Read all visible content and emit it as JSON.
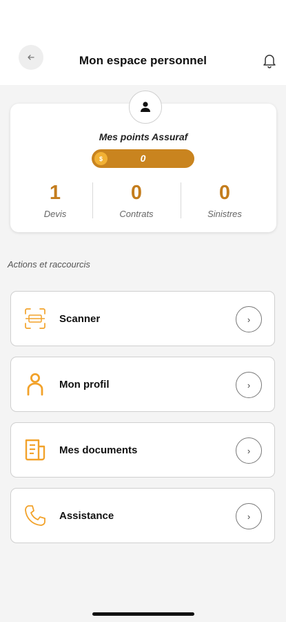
{
  "header": {
    "title": "Mon espace personnel",
    "back_icon": "arrow-left-icon",
    "notification_icon": "bell-icon"
  },
  "profile": {
    "avatar_icon": "person-icon",
    "points_title": "Mes points Assuraf",
    "points_coin": "$",
    "points_value": "0",
    "stats": [
      {
        "value": "1",
        "label": "Devis"
      },
      {
        "value": "0",
        "label": "Contrats"
      },
      {
        "value": "0",
        "label": "Sinistres"
      }
    ]
  },
  "actions": {
    "section_title": "Actions et raccourcis",
    "items": [
      {
        "label": "Scanner",
        "icon": "scan-icon",
        "chevron": "›"
      },
      {
        "label": "Mon profil",
        "icon": "user-icon",
        "chevron": "›"
      },
      {
        "label": "Mes documents",
        "icon": "document-icon",
        "chevron": "›"
      },
      {
        "label": "Assistance",
        "icon": "phone-icon",
        "chevron": "›"
      }
    ]
  },
  "colors": {
    "accent": "#c47d1d",
    "icon_orange": "#f2a22a",
    "points_bar": "#c9841f"
  }
}
